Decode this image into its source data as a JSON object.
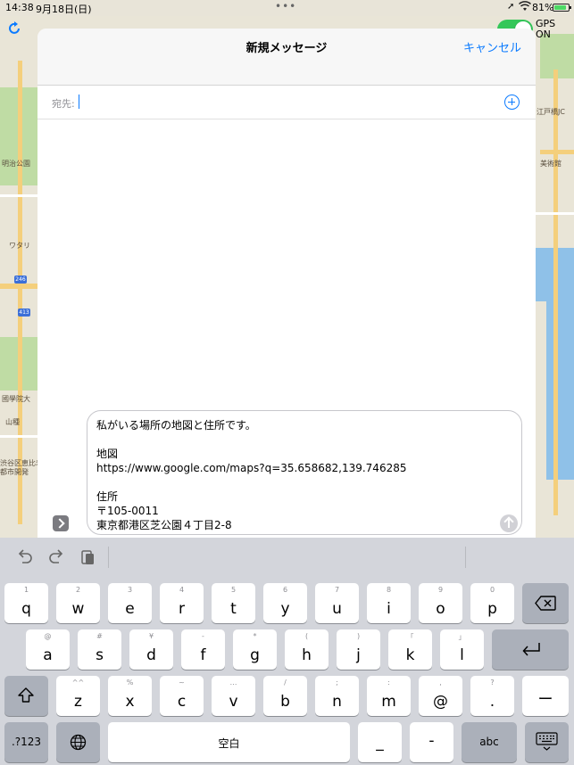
{
  "status_bar": {
    "time": "14:38",
    "date": "9月18日(日)",
    "dots": "•••",
    "battery_pct": "81%"
  },
  "map": {
    "labels": [
      "明治公園",
      "ワタリ",
      "246",
      "413",
      "國學院大",
      "山種",
      "渋谷区恵比寿",
      "都市開発",
      "江戸橋JC",
      "美術館"
    ],
    "gps_label": "GPS ON"
  },
  "compose": {
    "title": "新規メッセージ",
    "cancel": "キャンセル",
    "to_label": "宛先:",
    "message_lines": [
      "私がいる場所の地図と住所です。",
      "",
      "地図",
      "https://www.google.com/maps?q=35.658682,139.746285",
      "",
      "住所",
      "〒105-0011",
      "東京都港区芝公園４丁目2-8"
    ]
  },
  "keyboard": {
    "row1": [
      {
        "hint": "1",
        "key": "q"
      },
      {
        "hint": "2",
        "key": "w"
      },
      {
        "hint": "3",
        "key": "e"
      },
      {
        "hint": "4",
        "key": "r"
      },
      {
        "hint": "5",
        "key": "t"
      },
      {
        "hint": "6",
        "key": "y"
      },
      {
        "hint": "7",
        "key": "u"
      },
      {
        "hint": "8",
        "key": "i"
      },
      {
        "hint": "9",
        "key": "o"
      },
      {
        "hint": "0",
        "key": "p"
      }
    ],
    "row2": [
      {
        "hint": "@",
        "key": "a"
      },
      {
        "hint": "#",
        "key": "s"
      },
      {
        "hint": "¥",
        "key": "d"
      },
      {
        "hint": "-",
        "key": "f"
      },
      {
        "hint": "*",
        "key": "g"
      },
      {
        "hint": "(",
        "key": "h"
      },
      {
        "hint": ")",
        "key": "j"
      },
      {
        "hint": "「",
        "key": "k"
      },
      {
        "hint": "」",
        "key": "l"
      }
    ],
    "row3": [
      {
        "hint": "^^",
        "key": "z"
      },
      {
        "hint": "%",
        "key": "x"
      },
      {
        "hint": "~",
        "key": "c"
      },
      {
        "hint": "…",
        "key": "v"
      },
      {
        "hint": "/",
        "key": "b"
      },
      {
        "hint": ";",
        "key": "n"
      },
      {
        "hint": ":",
        "key": "m"
      },
      {
        "hint": ",",
        "key": "@"
      },
      {
        "hint": "?",
        "key": "."
      },
      {
        "hint": "",
        "key": "ー"
      }
    ],
    "num_key": ".?123",
    "space": "空白",
    "underscore": "_",
    "dash": "-",
    "abc": "abc",
    "icons": {
      "backspace": "backspace-icon",
      "return": "return-icon",
      "shift": "shift-icon",
      "globe": "globe-icon",
      "hide": "keyboard-hide-icon",
      "undo": "undo-icon",
      "redo": "redo-icon",
      "paste": "paste-icon"
    }
  }
}
